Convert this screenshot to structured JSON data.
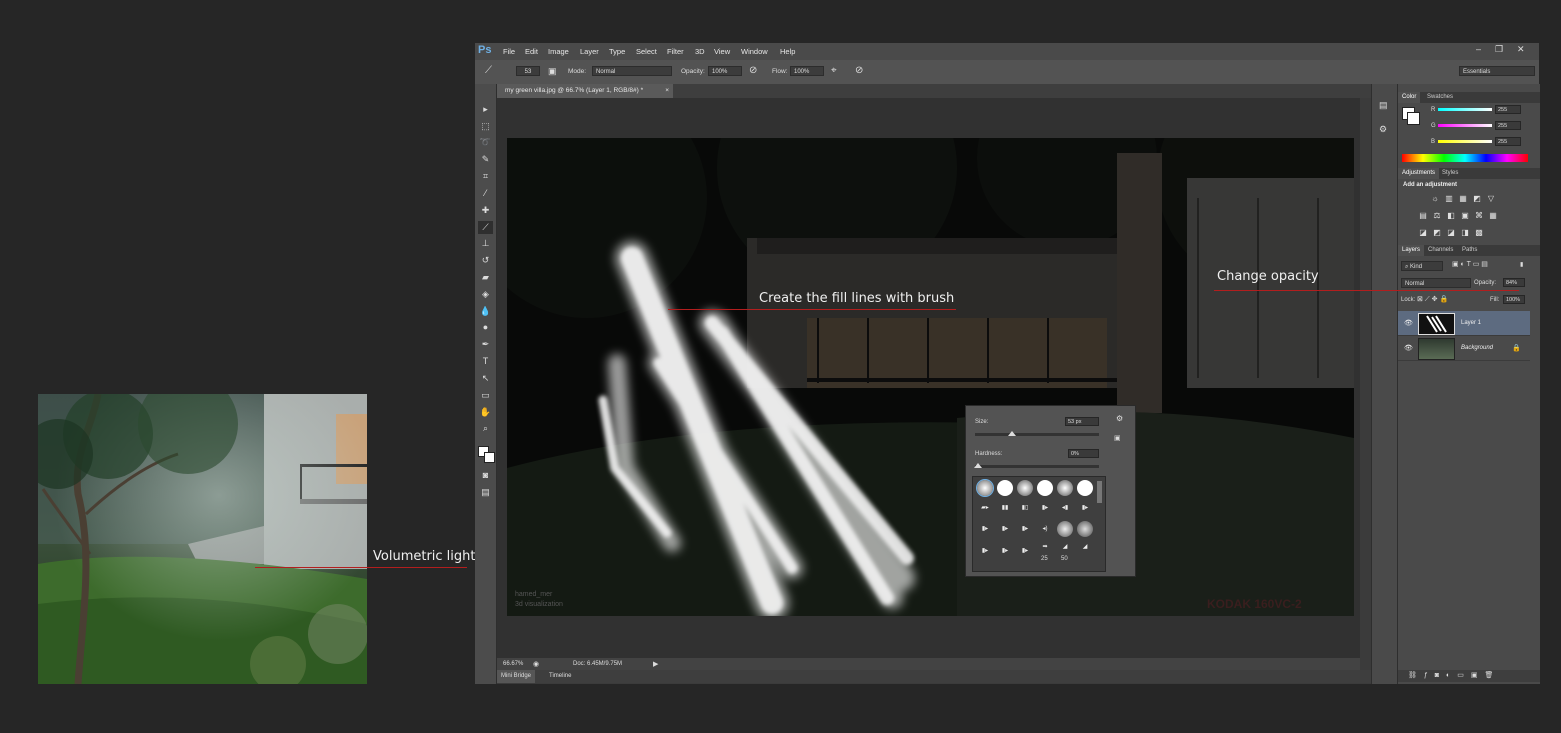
{
  "annotations": {
    "volumetric": "Volumetric light",
    "fill_lines": "Create the fill lines with brush",
    "opacity": "Change opacity"
  },
  "app": {
    "logo": "Ps",
    "menu": [
      "File",
      "Edit",
      "Image",
      "Layer",
      "Type",
      "Select",
      "Filter",
      "3D",
      "View",
      "Window",
      "Help"
    ],
    "window_controls": [
      "–",
      "❐",
      "✕"
    ]
  },
  "options_bar": {
    "brush_size": "53",
    "mode_label": "Mode:",
    "mode_value": "Normal",
    "opacity_label": "Opacity:",
    "opacity_value": "100%",
    "flow_label": "Flow:",
    "flow_value": "100%",
    "workspace": "Essentials"
  },
  "document": {
    "tab_title": "my green villa.jpg @ 66.7% (Layer 1, RGB/8#) *",
    "close": "×",
    "watermark_left_1": "hamed_mer",
    "watermark_left_2": "3d visualization",
    "watermark_right": "KODAK 160VC-2"
  },
  "status": {
    "zoom": "66.67%",
    "doc_size": "Doc: 6.45M/9.75M"
  },
  "bottom_tabs": [
    "Mini Bridge",
    "Timeline"
  ],
  "color_panel": {
    "tabs": [
      "Color",
      "Swatches"
    ],
    "channels": [
      {
        "label": "R",
        "value": "255",
        "color": "#00e0e0"
      },
      {
        "label": "G",
        "value": "255",
        "color": "#e000e0"
      },
      {
        "label": "B",
        "value": "255",
        "color": "#e0e000"
      }
    ]
  },
  "adjustments_panel": {
    "tabs": [
      "Adjustments",
      "Styles"
    ],
    "heading": "Add an adjustment",
    "icons_row1": [
      "☼",
      "▥",
      "▦",
      "◩",
      "▽"
    ],
    "icons_row2": [
      "▤",
      "⚖",
      "◧",
      "▣",
      "⌘",
      "▦"
    ],
    "icons_row3": [
      "◪",
      "◩",
      "◪",
      "◨",
      "▩"
    ]
  },
  "layers_panel": {
    "tabs": [
      "Layers",
      "Channels",
      "Paths"
    ],
    "kind": "Kind",
    "blend_mode": "Normal",
    "opacity_label": "Opacity:",
    "opacity_value": "84%",
    "lock_label": "Lock:",
    "fill_label": "Fill:",
    "fill_value": "100%",
    "layers": [
      {
        "name": "Layer 1"
      },
      {
        "name": "Background"
      }
    ]
  },
  "brush_picker": {
    "size_label": "Size:",
    "size_value": "53 px",
    "size_level": 0.3,
    "hardness_label": "Hardness:",
    "hardness_value": "0%",
    "hardness_level": 0.0,
    "preset_num_1": "25",
    "preset_num_2": "50"
  },
  "colors": {
    "accent": "#6fb0e4",
    "callout_line": "#b21e1e",
    "selected_layer": "#5d6b80"
  }
}
